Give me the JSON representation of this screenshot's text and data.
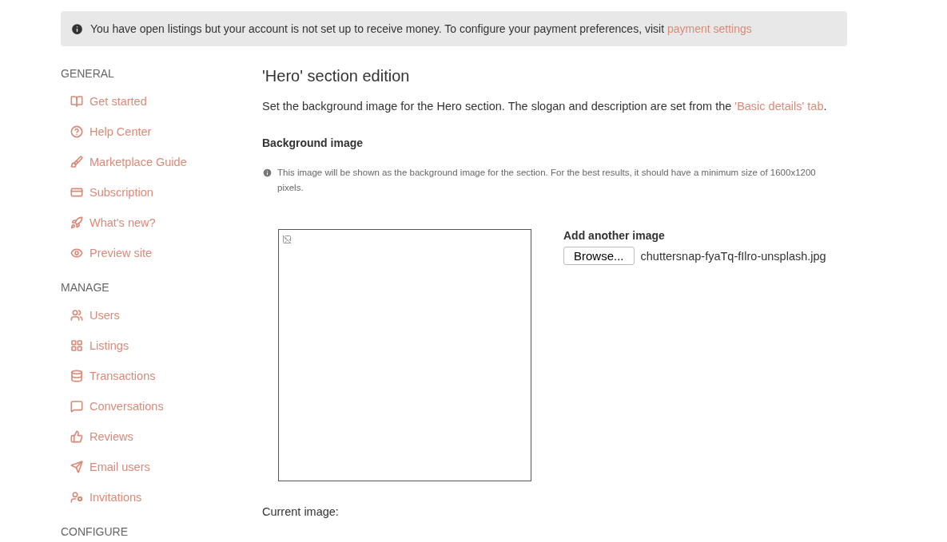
{
  "notice": {
    "text": "You have open listings but your account is not set up to receive money. To configure your payment preferences, visit ",
    "link": "payment settings"
  },
  "sidebar": [
    {
      "heading": "GENERAL",
      "items": [
        {
          "label": "Get started"
        },
        {
          "label": "Help Center"
        },
        {
          "label": "Marketplace Guide"
        },
        {
          "label": "Subscription"
        },
        {
          "label": "What's new?"
        },
        {
          "label": "Preview site"
        }
      ]
    },
    {
      "heading": "MANAGE",
      "items": [
        {
          "label": "Users"
        },
        {
          "label": "Listings"
        },
        {
          "label": "Transactions"
        },
        {
          "label": "Conversations"
        },
        {
          "label": "Reviews"
        },
        {
          "label": "Email users"
        },
        {
          "label": "Invitations"
        }
      ]
    },
    {
      "heading": "CONFIGURE"
    }
  ],
  "main": {
    "title": "'Hero' section edition",
    "intro": {
      "before": "Set the background image for the Hero section. The slogan and description are set from the ",
      "link": "'Basic details' tab",
      "after": "."
    },
    "field_label": "Background image",
    "hint": "This image will be shown as the background image for the section. For the best results, it should have a minimum size of 1600x1200 pixels.",
    "upload": {
      "label": "Add another image",
      "button": "Browse...",
      "file": "chuttersnap-fyaTq-fIlro-unsplash.jpg"
    },
    "current_label": "Current image:"
  }
}
